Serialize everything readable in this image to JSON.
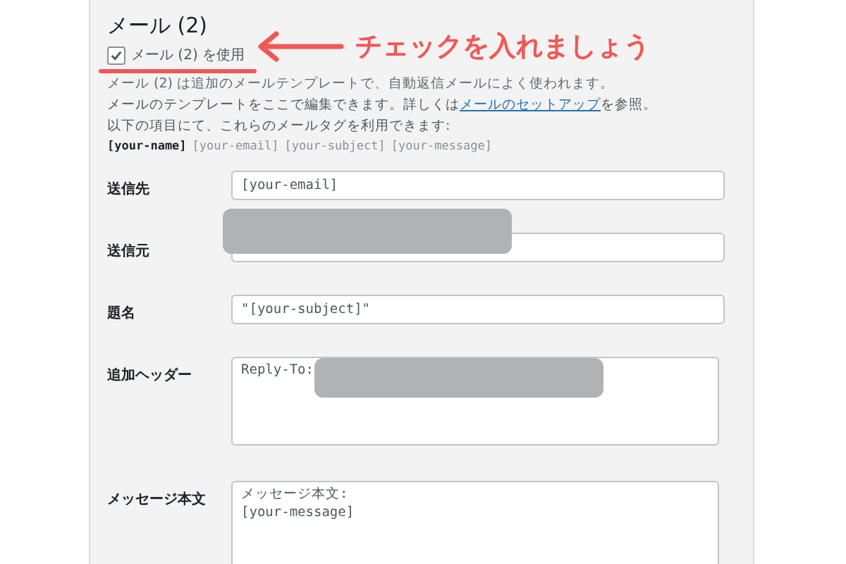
{
  "section": {
    "title": "メール (2)",
    "use_checkbox": {
      "label": "メール (2) を使用",
      "checked": true
    },
    "description": "メール (2) は追加のメールテンプレートで、自動返信メールによく使われます。",
    "help_before": "メールのテンプレートをここで編集できます。詳しくは",
    "help_link": "メールのセットアップ",
    "help_after": "を参照。",
    "tags_intro": "以下の項目にて、これらのメールタグを利用できます:",
    "tags": [
      {
        "text": "[your-name]",
        "used": true
      },
      {
        "text": "[your-email]",
        "used": false
      },
      {
        "text": "[your-subject]",
        "used": false
      },
      {
        "text": "[your-message]",
        "used": false
      }
    ]
  },
  "fields": [
    {
      "label": "送信先",
      "kind": "input",
      "value": "[your-email]",
      "redacted": false
    },
    {
      "label": "送信元",
      "kind": "input",
      "redacted": true
    },
    {
      "label": "題名",
      "kind": "input",
      "value": "\"[your-subject]\"",
      "redacted": false
    },
    {
      "label": "追加ヘッダー",
      "kind": "textarea",
      "value": "Reply-To:",
      "redacted": true
    },
    {
      "label": "メッセージ本文",
      "kind": "textarea",
      "value": "メッセージ本文:\n[your-message]",
      "redacted": false
    }
  ],
  "annotation": {
    "text": "チェックを入れましょう"
  }
}
